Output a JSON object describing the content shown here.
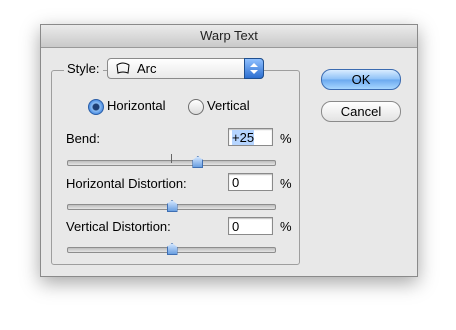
{
  "window": {
    "title": "Warp Text"
  },
  "style": {
    "label": "Style:",
    "value": "Arc",
    "icon": "arc-warp-icon"
  },
  "orientation": {
    "horizontal_label": "Horizontal",
    "vertical_label": "Vertical",
    "selected": "Horizontal"
  },
  "bend": {
    "label": "Bend:",
    "value": "+25",
    "unit": "%",
    "slider_fraction": 0.625
  },
  "horizontal_distortion": {
    "label": "Horizontal Distortion:",
    "value": "0",
    "unit": "%",
    "slider_fraction": 0.5
  },
  "vertical_distortion": {
    "label": "Vertical Distortion:",
    "value": "0",
    "unit": "%",
    "slider_fraction": 0.5
  },
  "buttons": {
    "ok_label": "OK",
    "cancel_label": "Cancel"
  }
}
